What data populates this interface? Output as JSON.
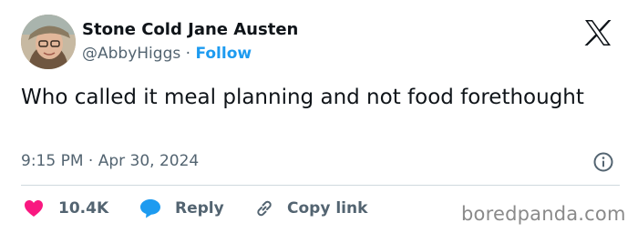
{
  "author": {
    "display_name": "Stone Cold Jane Austen",
    "handle": "@AbbyHiggs",
    "separator": "·",
    "follow_label": "Follow"
  },
  "platform": {
    "logo_icon": "x-logo-icon"
  },
  "tweet": {
    "text": "Who called it meal planning and not food forethought",
    "timestamp": "9:15 PM · Apr 30, 2024",
    "info_icon": "info-circle-icon"
  },
  "actions": {
    "like_count": "10.4K",
    "like_icon": "heart-icon",
    "reply_label": "Reply",
    "reply_icon": "speech-bubble-icon",
    "copy_link_label": "Copy link",
    "copy_link_icon": "link-icon"
  },
  "watermark": "boredpanda.com",
  "colors": {
    "text_primary": "#0f1419",
    "text_secondary": "#536471",
    "follow_blue": "#1d9bf0",
    "like_pink": "#f91880",
    "divider": "#cfd9de",
    "watermark": "#8a8a8a"
  }
}
